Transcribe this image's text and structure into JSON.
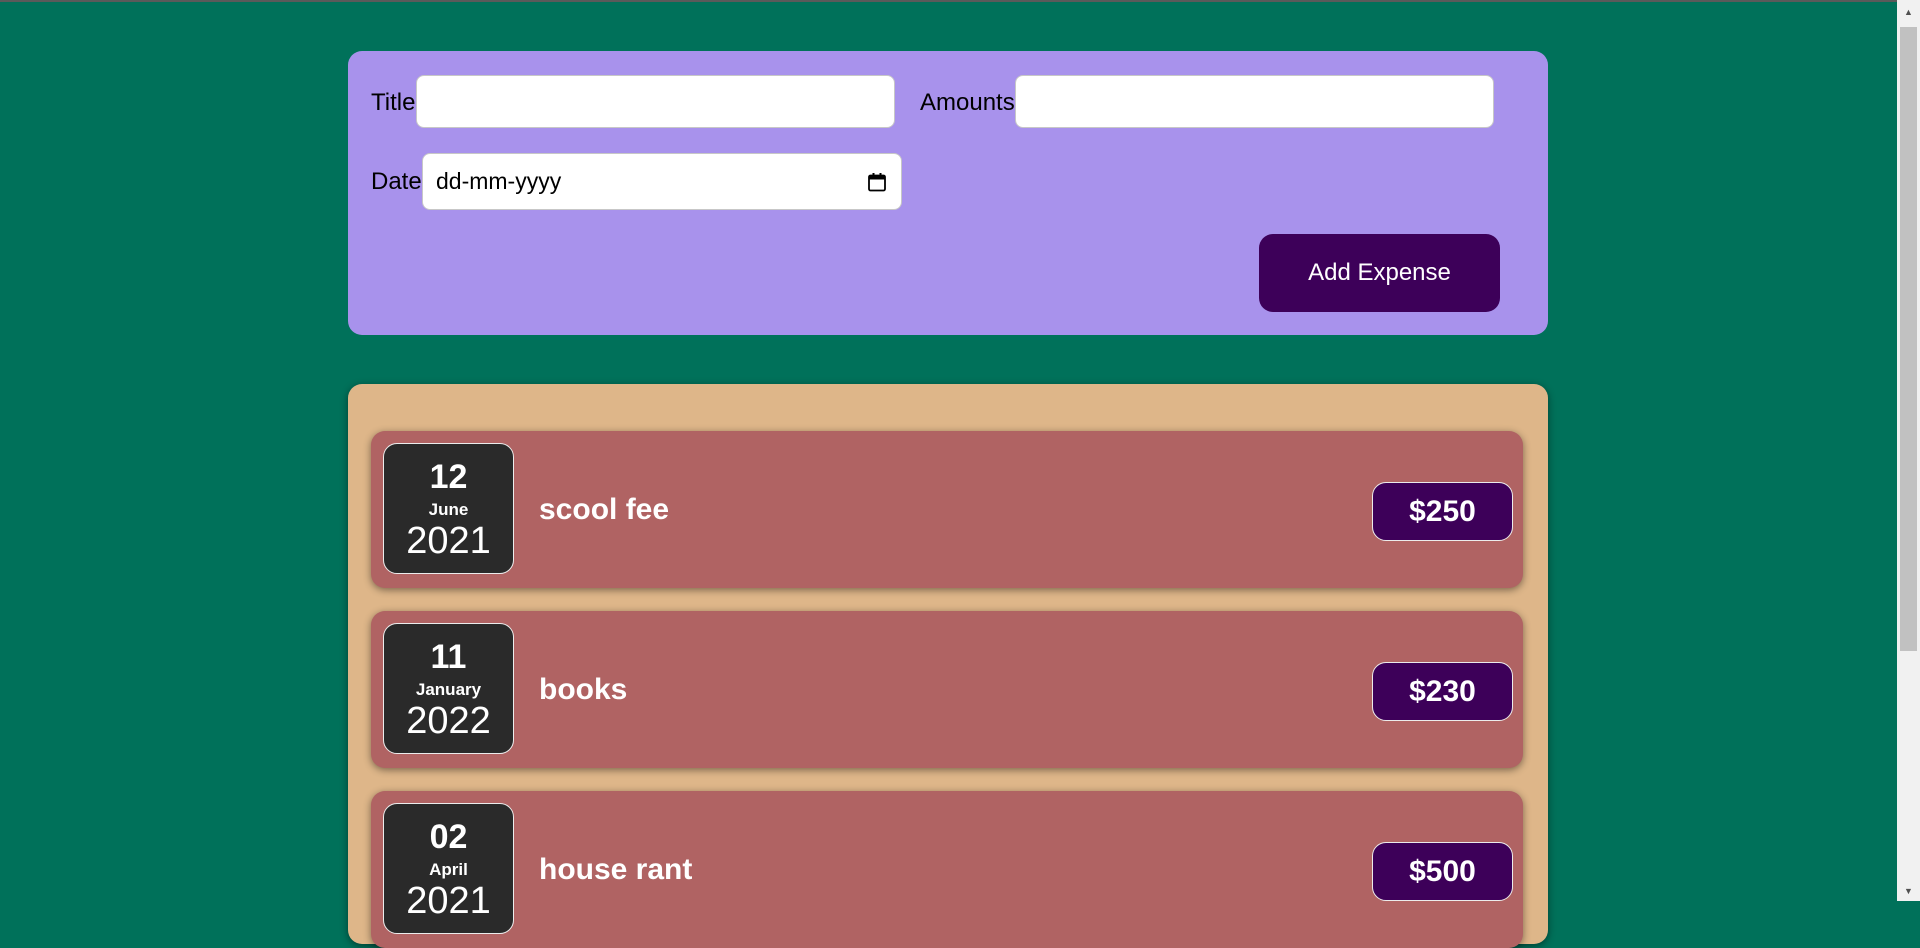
{
  "form": {
    "title_label": "Title",
    "title_value": "",
    "amount_label": "Amounts",
    "amount_value": "",
    "date_label": "Date",
    "date_placeholder": "dd-mm-yyyy",
    "add_button_label": "Add Expense"
  },
  "expenses": [
    {
      "day": "12",
      "month": "June",
      "year": "2021",
      "title": "scool fee",
      "amount": "$250"
    },
    {
      "day": "11",
      "month": "January",
      "year": "2022",
      "title": "books",
      "amount": "$230"
    },
    {
      "day": "02",
      "month": "April",
      "year": "2021",
      "title": "house rant",
      "amount": "$500"
    }
  ],
  "colors": {
    "background": "#00715a",
    "form_panel": "#a892ec",
    "list_panel": "#deb689",
    "expense_item": "#b06363",
    "date_card": "#2a2a2a",
    "button": "#3d0059"
  },
  "icons": {
    "date_picker": "calendar-icon"
  }
}
